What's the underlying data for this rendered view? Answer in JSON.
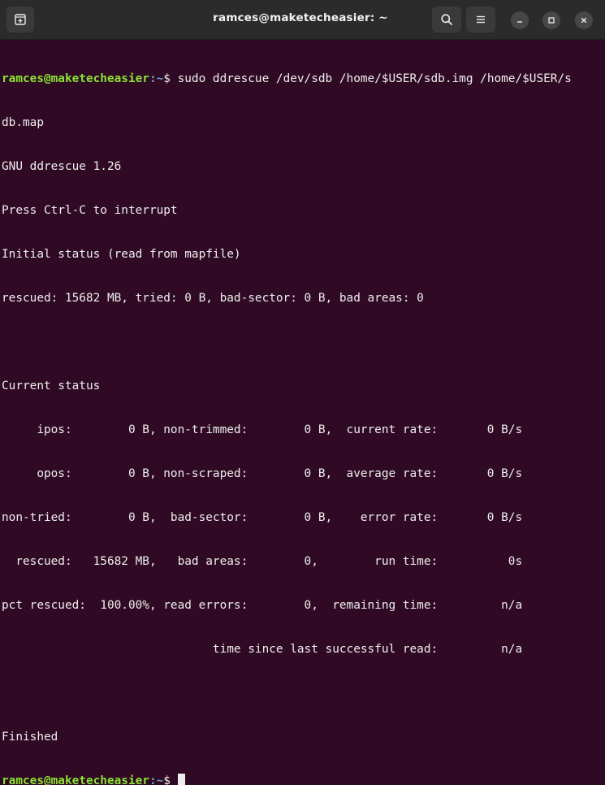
{
  "window": {
    "title": "ramces@maketecheasier: ~"
  },
  "prompt": {
    "user_host": "ramces@maketecheasier",
    "path": ":~",
    "symbol": "$ "
  },
  "command": {
    "text": "sudo ddrescue /dev/sdb /home/$USER/sdb.img /home/$USER/s",
    "wrap": "db.map"
  },
  "output": {
    "lines": [
      "GNU ddrescue 1.26",
      "Press Ctrl-C to interrupt",
      "Initial status (read from mapfile)",
      "rescued: 15682 MB, tried: 0 B, bad-sector: 0 B, bad areas: 0",
      "",
      "Current status",
      "     ipos:        0 B, non-trimmed:        0 B,  current rate:       0 B/s",
      "     opos:        0 B, non-scraped:        0 B,  average rate:       0 B/s",
      "non-tried:        0 B,  bad-sector:        0 B,    error rate:       0 B/s",
      "  rescued:   15682 MB,   bad areas:        0,        run time:          0s",
      "pct rescued:  100.00%, read errors:        0,  remaining time:         n/a",
      "                              time since last successful read:         n/a",
      "",
      "Finished"
    ]
  },
  "icons": {
    "new_tab": "new-tab-icon",
    "search": "search-icon",
    "menu": "hamburger-menu-icon",
    "minimize": "minimize-icon",
    "maximize": "maximize-icon",
    "close": "close-icon"
  },
  "colors": {
    "background": "#300a24",
    "titlebar": "#2b2b2b",
    "prompt_user": "#8ae234",
    "prompt_path": "#729fcf",
    "text": "#eeeeec"
  }
}
